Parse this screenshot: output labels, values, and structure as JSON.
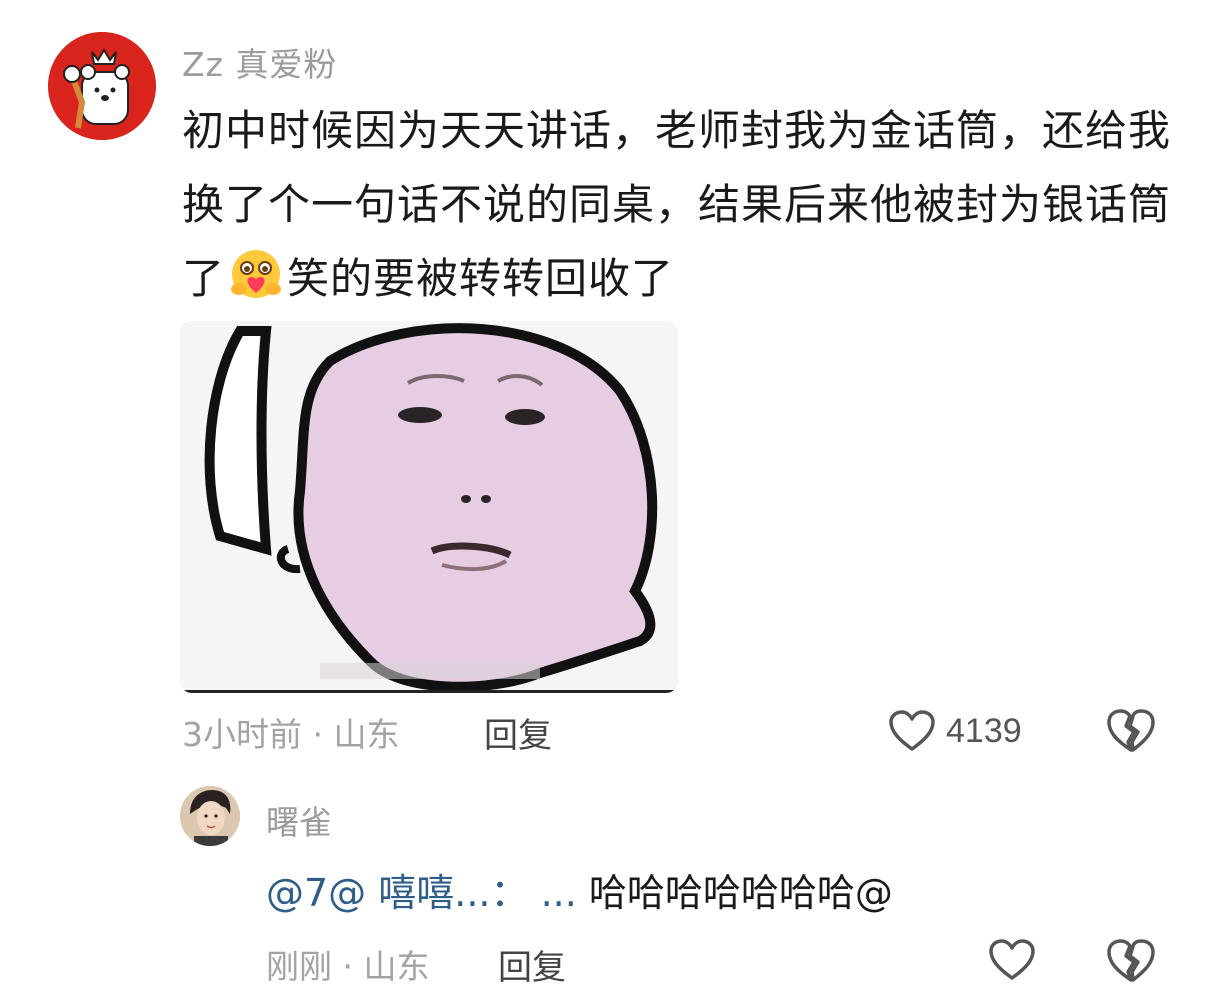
{
  "comment": {
    "author": "Zz 真爱粉",
    "text_before_emoji": "初中时候因为天天讲话，老师封我为金话筒，还给我换了个一句话不说的同桌，结果后来他被封为银话筒了",
    "emoji": "hugging-face-emoji",
    "text_after_emoji": "笑的要被转转回收了",
    "meta": "3小时前 · 山东",
    "reply_label": "回复",
    "like_count": "4139"
  },
  "reply": {
    "author": "曙雀",
    "mention": "@7@ 嘻嘻...：  ...",
    "text": "  哈哈哈哈哈哈哈@",
    "meta": "刚刚 · 山东",
    "reply_label": "回复"
  },
  "colors": {
    "avatar_bg": "#d9231d",
    "mention": "#2f5d8a",
    "muted": "#9c9c9c"
  }
}
